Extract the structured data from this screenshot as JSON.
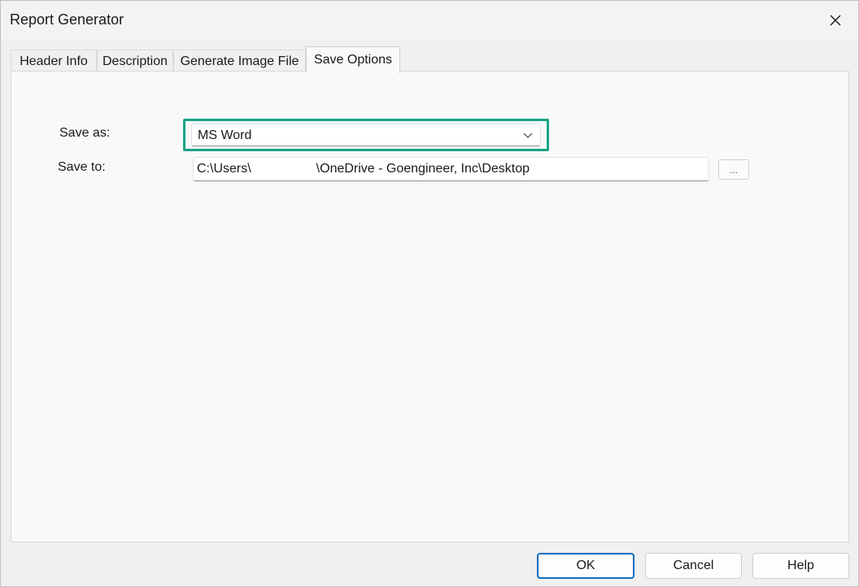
{
  "window": {
    "title": "Report Generator",
    "close_icon": "close-icon"
  },
  "tabs": [
    {
      "label": "Header Info",
      "active": false
    },
    {
      "label": "Description",
      "active": false
    },
    {
      "label": "Generate Image File",
      "active": false
    },
    {
      "label": "Save Options",
      "active": true
    }
  ],
  "save_options": {
    "save_as_label": "Save as:",
    "save_as_value": "MS Word",
    "save_to_label": "Save to:",
    "save_to_prefix": "C:\\Users\\",
    "save_to_suffix": "\\OneDrive - Goengineer, Inc\\Desktop",
    "browse_label": "...",
    "highlight_color": "#1aa386"
  },
  "buttons": {
    "ok": "OK",
    "cancel": "Cancel",
    "help": "Help"
  }
}
